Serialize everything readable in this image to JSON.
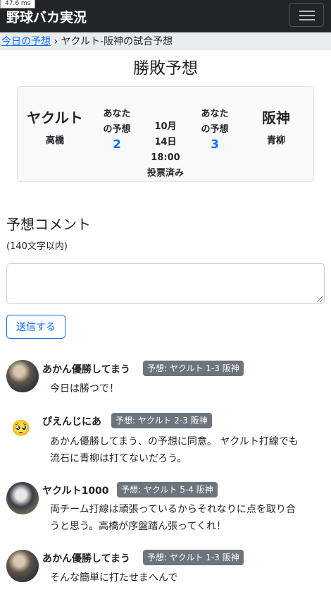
{
  "debug": {
    "timing": "47.6 ms"
  },
  "nav": {
    "brand": "野球バカ実況",
    "menu_icon": "hamburger-icon"
  },
  "breadcrumb": {
    "home": "今日の予想",
    "separator": "›",
    "current": "ヤクルト-阪神の試合予想"
  },
  "page_title": "勝敗予想",
  "match": {
    "home": {
      "team": "ヤクルト",
      "pitcher": "高橋"
    },
    "away": {
      "team": "阪神",
      "pitcher": "青柳"
    },
    "your_pred_label_line1": "あなた",
    "your_pred_label_line2": "の予想",
    "home_pred": "2",
    "away_pred": "3",
    "date_line1": "10月",
    "date_line2": "14日",
    "time": "18:00",
    "status": "投票済み"
  },
  "comment_form": {
    "title": "予想コメント",
    "limit": "(140文字以内)",
    "value": "",
    "submit": "送信する"
  },
  "comments": [
    {
      "user": "あかん優勝してまう",
      "avatar": "player-photo",
      "prediction": "予想: ヤクルト 1-3 阪神",
      "lines": [
        "今日は勝つで！"
      ]
    },
    {
      "user": "ぴえんじにあ",
      "avatar": "pleading-face-emoji",
      "emoji": "🥺",
      "prediction": "予想: ヤクルト 2-3 阪神",
      "lines": [
        "あかん優勝してまう、の予想に同意。 ヤクルト打線でも",
        "流石に青柳は打てないだろう。"
      ]
    },
    {
      "user": "ヤクルト1000",
      "avatar": "mascot-photo",
      "prediction": "予想: ヤクルト 5-4 阪神",
      "lines": [
        "両チーム打線は頑張っているからそれなりに点を取り合",
        "うと思う。高橋が序盤踏ん張ってくれ！"
      ]
    },
    {
      "user": "あかん優勝してまう",
      "avatar": "player-photo",
      "prediction": "予想: ヤクルト 1-3 阪神",
      "lines": [
        "そんな簡単に打たせまへんで"
      ]
    }
  ]
}
